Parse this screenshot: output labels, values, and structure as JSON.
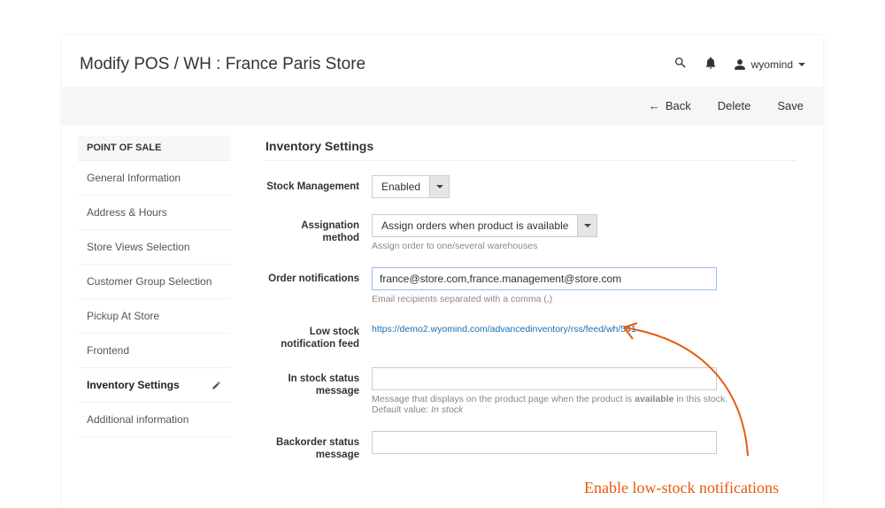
{
  "page_title": "Modify POS / WH : France Paris Store",
  "user": {
    "name": "wyomind"
  },
  "actions": {
    "back": "Back",
    "delete": "Delete",
    "save": "Save"
  },
  "sidebar": {
    "title": "POINT OF SALE",
    "items": [
      {
        "label": "General Information"
      },
      {
        "label": "Address & Hours"
      },
      {
        "label": "Store Views Selection"
      },
      {
        "label": "Customer Group Selection"
      },
      {
        "label": "Pickup At Store"
      },
      {
        "label": "Frontend"
      },
      {
        "label": "Inventory Settings"
      },
      {
        "label": "Additional information"
      }
    ],
    "selected_index": 6
  },
  "section": {
    "title": "Inventory Settings",
    "stock_mgmt": {
      "label": "Stock Management",
      "value": "Enabled"
    },
    "assignation": {
      "label": "Assignation method",
      "value": "Assign orders when product is available",
      "hint": "Assign order to one/several warehouses"
    },
    "order_notifications": {
      "label": "Order notifications",
      "value": "france@store.com,france.management@store.com",
      "hint": "Email recipients separated with a comma (,)"
    },
    "low_stock_feed": {
      "label": "Low stock notification feed",
      "url": "https://demo2.wyomind.com/advancedinventory/rss/feed/wh/541"
    },
    "in_stock_msg": {
      "label": "In stock status message",
      "value": "",
      "hint_1": "Message that displays on the product page when the product is ",
      "hint_bold": "available",
      "hint_2": " in this stock.",
      "hint_3": "Default value: ",
      "hint_default": "In stock"
    },
    "backorder_msg": {
      "label": "Backorder status message",
      "value": ""
    }
  },
  "annotation": "Enable low-stock notifications"
}
